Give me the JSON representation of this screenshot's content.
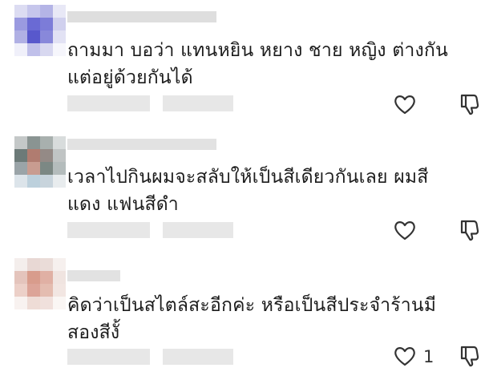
{
  "comments": [
    {
      "text_line1": "ถามมา บอว่า แทนหยิน หยาง ชาย หญิง ต่างกัน",
      "text_line2": "แต่อยู่ด้วยกันได้",
      "like_count": "",
      "avatar_colors": [
        "#dcdcf2",
        "#c6c6ec",
        "#b4b4e6",
        "#e8e8f6",
        "#9a9ae0",
        "#6a6ad4",
        "#7c7cd8",
        "#d0d0ee",
        "#b0b0e4",
        "#5858cc",
        "#8888da",
        "#e2e2f4",
        "#f0f0fa",
        "#c0c0ea",
        "#d8d8f0",
        "#f6f6fc"
      ],
      "name_color": "#dedede",
      "meta_color": "#e7e7e7",
      "icons": {
        "like": "heart-outline-icon",
        "dislike": "thumbs-down-outline-icon"
      }
    },
    {
      "text_line1": "เวลาไปกินผมจะสลับให้เป็นสีเดียวกันเลย ผมสี",
      "text_line2": "แดง แฟนสีดำ",
      "like_count": "",
      "avatar_colors": [
        "#c4c8c8",
        "#8a9492",
        "#a8b0ae",
        "#d8dcdc",
        "#6c7a78",
        "#b07c70",
        "#948a86",
        "#c0c4c4",
        "#9aa4a8",
        "#c89c90",
        "#7c8884",
        "#b4bcbc",
        "#dce4ea",
        "#bcd0dc",
        "#c8d4dc",
        "#e8ecee"
      ],
      "name_color": "#e2e2e2",
      "meta_color": "#e7e7e7",
      "icons": {
        "like": "heart-outline-icon",
        "dislike": "thumbs-down-outline-icon"
      }
    },
    {
      "text_line1": "คิดว่าเป็นสไตล์สะอีกค่ะ หรือเป็นสีประจำร้านมี",
      "text_line2": "สองสีงั้",
      "like_count": "1",
      "avatar_colors": [
        "#f4eeec",
        "#e8d8d4",
        "#eadcd8",
        "#f6f0ee",
        "#e4c4bc",
        "#d89c8c",
        "#e0b0a4",
        "#f0e4e0",
        "#ecd0c8",
        "#dca498",
        "#e4bcb0",
        "#f2e6e2",
        "#f8f2f0",
        "#eedcd6",
        "#f0e0dc",
        "#faf6f4"
      ],
      "name_color": "#e2e2e2",
      "meta_color": "#e7e7e7",
      "icons": {
        "like": "heart-outline-icon",
        "dislike": "thumbs-down-outline-icon"
      }
    }
  ]
}
